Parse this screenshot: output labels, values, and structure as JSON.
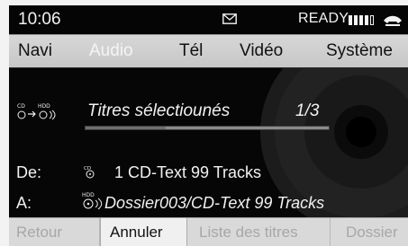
{
  "status": {
    "time": "10:06",
    "ready": "READY",
    "icons": [
      "mail-icon",
      "signal-strength-icon",
      "phone-icon"
    ]
  },
  "menu": {
    "items": [
      {
        "label": "Navi",
        "active": false
      },
      {
        "label": "Audio",
        "active": true
      },
      {
        "label": "Tél",
        "active": false
      },
      {
        "label": "Vidéo",
        "active": false
      },
      {
        "label": "Système",
        "active": false
      }
    ]
  },
  "transfer": {
    "label": "Titres sélectiounés",
    "count": "1/3",
    "progress": 0.33,
    "from_label": "De:",
    "source": "1 CD-Text 99 Tracks",
    "to_label": "A:",
    "destination": "Dossier003/CD-Text 99 Tracks"
  },
  "softkeys": {
    "back": "Retour",
    "cancel": "Annuler",
    "track_list": "Liste des titres",
    "folder": "Dossier"
  },
  "colors": {
    "screen_background": "#060606",
    "menu_background": "#d0d0d0",
    "active_menu_text": "#f3f3f3",
    "inactive_softkey": "#a7a7a7"
  }
}
